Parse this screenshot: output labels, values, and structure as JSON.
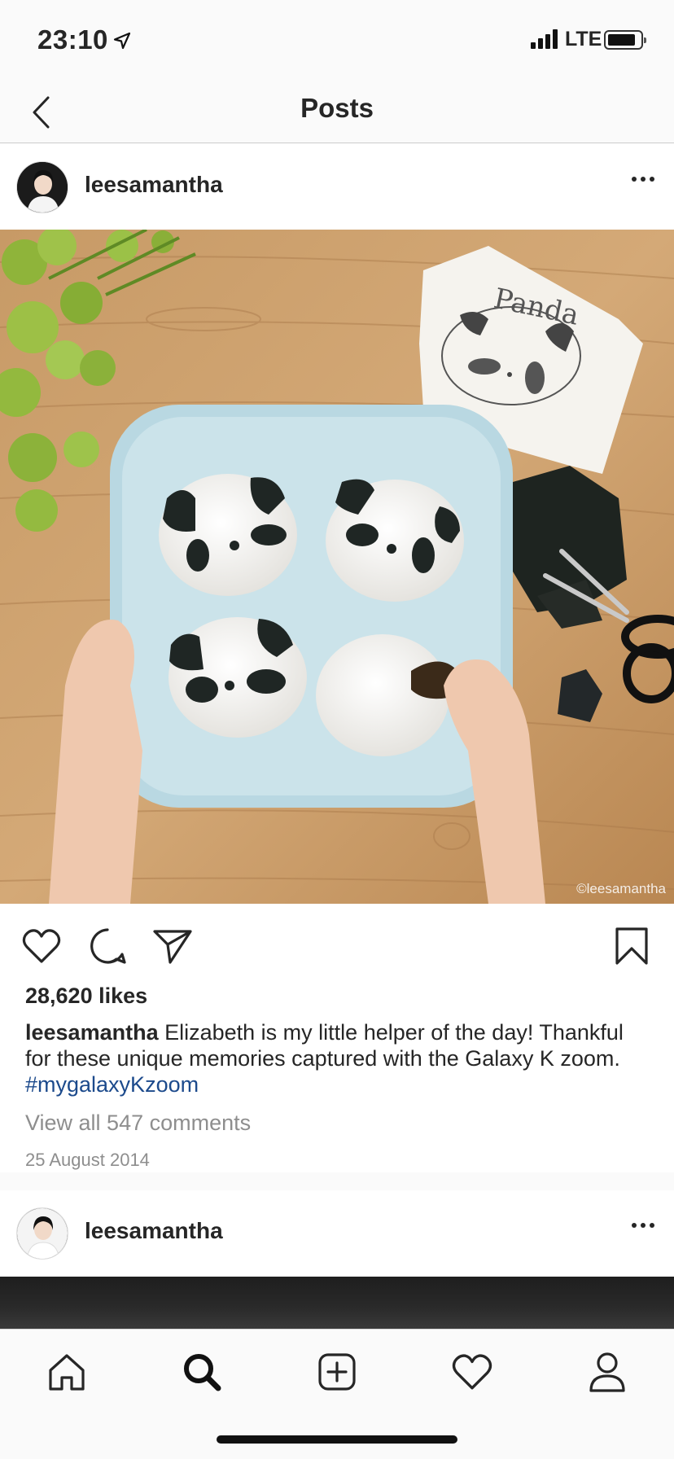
{
  "status_bar": {
    "time": "23:10",
    "network": "LTE"
  },
  "nav": {
    "title": "Posts"
  },
  "post": {
    "username": "leesamantha",
    "watermark": "©leesamantha",
    "image_caption_on_paper": "Panda",
    "likes": "28,620 likes",
    "caption_user": "leesamantha",
    "caption_text": "Elizabeth is my little helper of the day! Thankful for these unique memories captured with the Galaxy K zoom.",
    "hashtag": "#mygalaxyKzoom",
    "view_comments": "View all 547 comments",
    "date": "25 August 2014"
  },
  "next_post": {
    "username": "leesamantha"
  },
  "tab_bar": {
    "items": [
      {
        "icon": "home-icon"
      },
      {
        "icon": "search-icon",
        "active": true
      },
      {
        "icon": "add-post-icon"
      },
      {
        "icon": "activity-heart-icon"
      },
      {
        "icon": "profile-icon"
      }
    ]
  }
}
